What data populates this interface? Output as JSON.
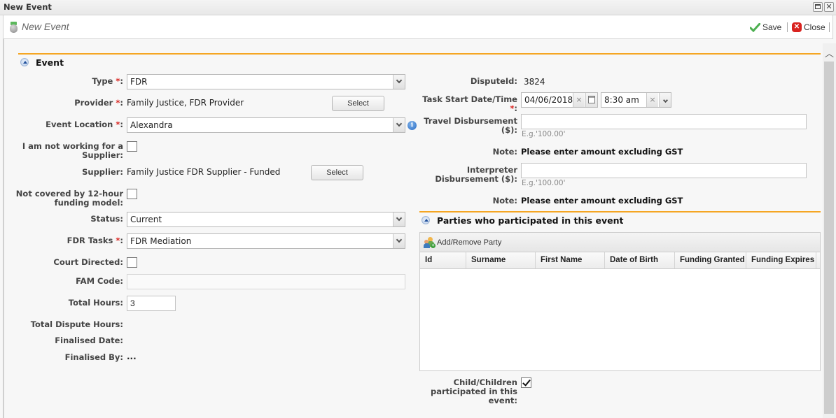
{
  "window": {
    "title": "New Event",
    "maximize_icon": "maximize-icon",
    "close_icon": "close-icon"
  },
  "toolbar": {
    "heading": "New Event",
    "save_label": "Save",
    "close_label": "Close",
    "close_glyph": "✕"
  },
  "colors": {
    "section_accent": "#f5a623",
    "required": "#d9231f",
    "save_green": "#4caf50",
    "close_red": "#d9231f"
  },
  "event_section": {
    "title": "Event",
    "type_label": "Type",
    "type_value": "FDR",
    "provider_label": "Provider",
    "provider_value": "Family Justice, FDR Provider",
    "provider_select_label": "Select",
    "event_location_label": "Event Location",
    "event_location_value": "Alexandra",
    "info_glyph": "i",
    "not_working_supplier_label_1": "I am not working for a",
    "not_working_supplier_label_2": "Supplier:",
    "not_working_supplier_checked": false,
    "supplier_label": "Supplier:",
    "supplier_value": "Family Justice FDR Supplier - Funded",
    "supplier_select_label": "Select",
    "not_covered_label_1": "Not covered by 12-hour",
    "not_covered_label_2": "funding model:",
    "not_covered_checked": false,
    "status_label": "Status:",
    "status_value": "Current",
    "fdr_tasks_label": "FDR Tasks",
    "fdr_tasks_value": "FDR Mediation",
    "court_directed_label": "Court Directed:",
    "court_directed_checked": false,
    "fam_code_label": "FAM Code:",
    "fam_code_value": "",
    "total_hours_label": "Total Hours:",
    "total_hours_value": "3",
    "total_dispute_hours_label": "Total Dispute Hours:",
    "total_dispute_hours_value": "",
    "finalised_date_label": "Finalised Date:",
    "finalised_date_value": "",
    "finalised_by_label": "Finalised By:",
    "finalised_by_value": "..."
  },
  "right_section": {
    "dispute_id_label": "DisputeId:",
    "dispute_id_value": "3824",
    "task_start_label": "Task Start Date/Time",
    "task_start_date": "04/06/2018",
    "task_start_time": "8:30 am",
    "clear_glyph": "×",
    "travel_label": "Travel Disbursement ($):",
    "travel_value": "",
    "travel_hint": "E.g.'100.00'",
    "note_label": "Note:",
    "note_text": "Please enter amount excluding GST",
    "interpreter_label_1": "Interpreter",
    "interpreter_label_2": "Disbursement ($):",
    "interpreter_value": "",
    "interpreter_hint": "E.g.'100.00'",
    "note2_label": "Note:",
    "note2_text": "Please enter amount excluding GST"
  },
  "parties_section": {
    "title": "Parties who participated in this event",
    "add_remove_label": "Add/Remove Party",
    "columns": [
      "Id",
      "Surname",
      "First Name",
      "Date of Birth",
      "Funding Granted",
      "Funding Expires"
    ],
    "rows": [],
    "child_label_1": "Child/Children",
    "child_label_2": "participated in this",
    "child_label_3": "event:",
    "child_checked": true
  },
  "required_marker": "*",
  "colon": ":"
}
